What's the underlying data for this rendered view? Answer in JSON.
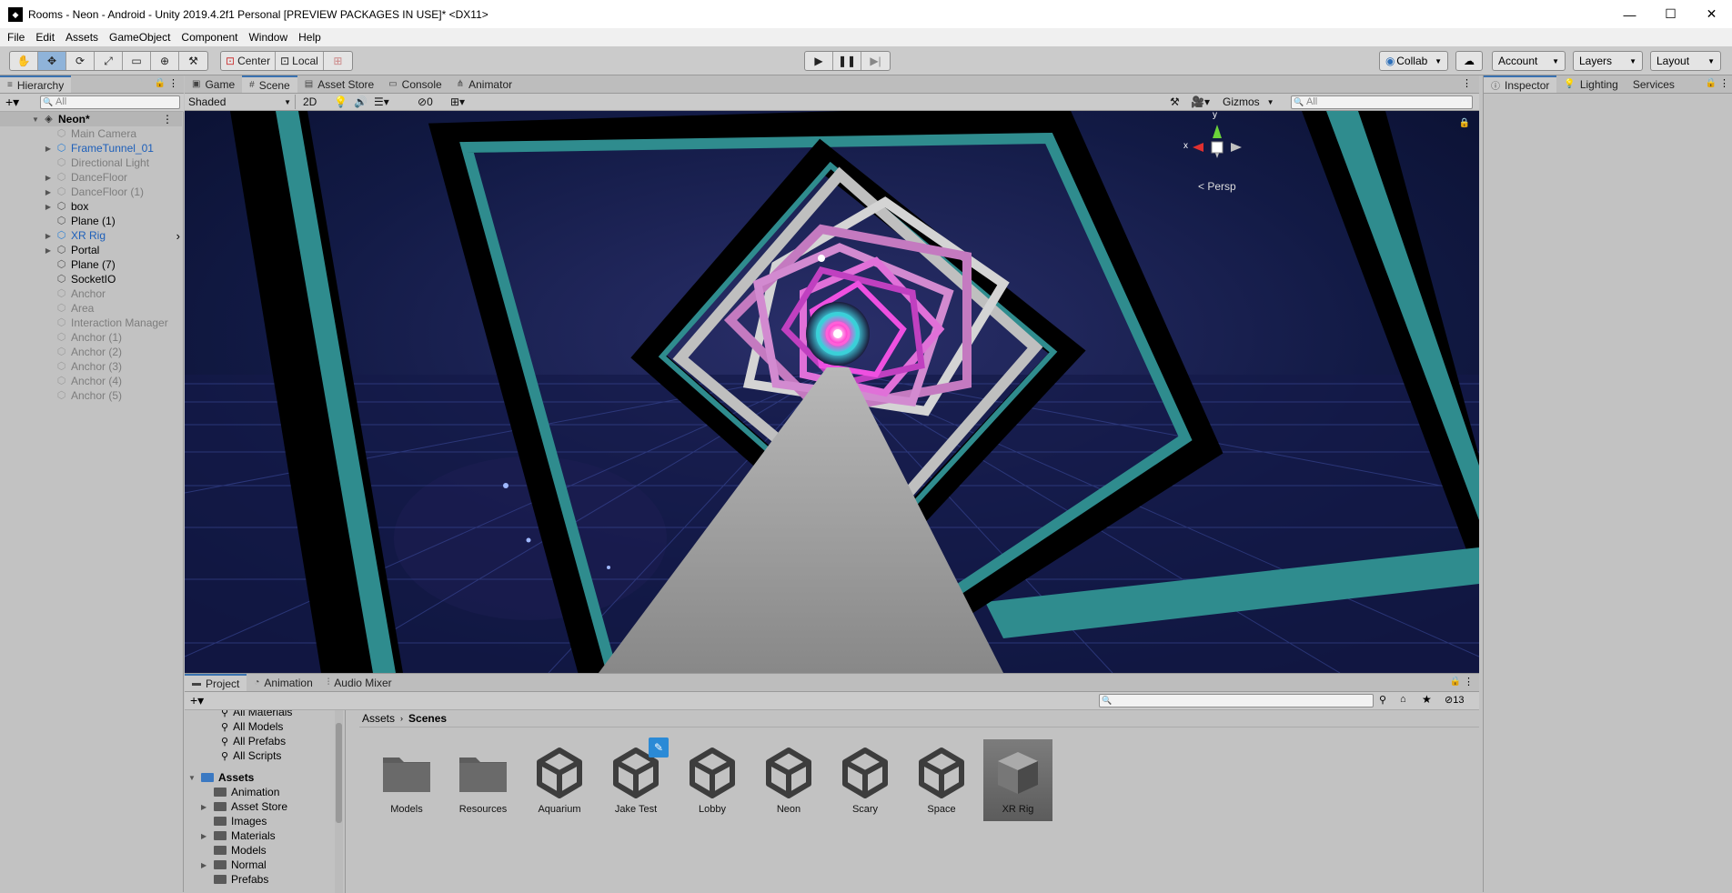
{
  "window": {
    "title": "Rooms - Neon - Android - Unity 2019.4.2f1 Personal [PREVIEW PACKAGES IN USE]* <DX11>",
    "controls": [
      "—",
      "☐",
      "✕"
    ]
  },
  "menu": [
    "File",
    "Edit",
    "Assets",
    "GameObject",
    "Component",
    "Window",
    "Help"
  ],
  "toolbar": {
    "pivot_center": "Center",
    "pivot_local": "Local",
    "collab": "Collab",
    "account": "Account",
    "layers": "Layers",
    "layout": "Layout"
  },
  "hierarchy": {
    "tab": "Hierarchy",
    "search_placeholder": "All",
    "scene": "Neon*",
    "items": [
      {
        "name": "Main Camera",
        "state": "inactive",
        "expand": false
      },
      {
        "name": "FrameTunnel_01",
        "state": "prefab",
        "expand": true
      },
      {
        "name": "Directional Light",
        "state": "inactive",
        "expand": false
      },
      {
        "name": "DanceFloor",
        "state": "inactive",
        "expand": true
      },
      {
        "name": "DanceFloor (1)",
        "state": "inactive",
        "expand": true
      },
      {
        "name": "box",
        "state": "normal",
        "expand": true
      },
      {
        "name": "Plane (1)",
        "state": "normal",
        "expand": false
      },
      {
        "name": "XR Rig",
        "state": "prefab",
        "expand": true
      },
      {
        "name": "Portal",
        "state": "normal",
        "expand": true
      },
      {
        "name": "Plane (7)",
        "state": "normal",
        "expand": false
      },
      {
        "name": "SocketIO",
        "state": "normal",
        "expand": false
      },
      {
        "name": "Anchor",
        "state": "inactive",
        "expand": false
      },
      {
        "name": "Area",
        "state": "inactive",
        "expand": false
      },
      {
        "name": "Interaction Manager",
        "state": "inactive",
        "expand": false
      },
      {
        "name": "Anchor (1)",
        "state": "inactive",
        "expand": false
      },
      {
        "name": "Anchor (2)",
        "state": "inactive",
        "expand": false
      },
      {
        "name": "Anchor (3)",
        "state": "inactive",
        "expand": false
      },
      {
        "name": "Anchor (4)",
        "state": "inactive",
        "expand": false
      },
      {
        "name": "Anchor (5)",
        "state": "inactive",
        "expand": false
      }
    ]
  },
  "scene_tabs": [
    "Game",
    "Scene",
    "Asset Store",
    "Console",
    "Animator"
  ],
  "scene_toolbar": {
    "shading": "Shaded",
    "mode_2d": "2D",
    "hidden_count": "0",
    "gizmos": "Gizmos",
    "search_placeholder": "All"
  },
  "viewport": {
    "projection": "< Persp",
    "axis_x": "x",
    "axis_y": "y"
  },
  "inspector_tabs": [
    "Inspector",
    "Lighting",
    "Services"
  ],
  "project": {
    "tabs": [
      "Project",
      "Animation",
      "Audio Mixer"
    ],
    "hidden_count": "13",
    "tree": [
      {
        "label": "All Materials",
        "kind": "search"
      },
      {
        "label": "All Models",
        "kind": "search"
      },
      {
        "label": "All Prefabs",
        "kind": "search"
      },
      {
        "label": "All Scripts",
        "kind": "search"
      },
      {
        "label": "Assets",
        "kind": "root"
      },
      {
        "label": "Animation",
        "kind": "folder",
        "expand": false
      },
      {
        "label": "Asset Store",
        "kind": "folder",
        "expand": true
      },
      {
        "label": "Images",
        "kind": "folder",
        "expand": false
      },
      {
        "label": "Materials",
        "kind": "folder",
        "expand": true
      },
      {
        "label": "Models",
        "kind": "folder",
        "expand": false
      },
      {
        "label": "Normal",
        "kind": "folder",
        "expand": true
      },
      {
        "label": "Prefabs",
        "kind": "folder",
        "expand": false
      }
    ],
    "breadcrumb": [
      "Assets",
      "Scenes"
    ],
    "assets": [
      {
        "label": "Models",
        "type": "folder"
      },
      {
        "label": "Resources",
        "type": "folder"
      },
      {
        "label": "Aquarium",
        "type": "scene"
      },
      {
        "label": "Jake Test",
        "type": "scene"
      },
      {
        "label": "Lobby",
        "type": "scene"
      },
      {
        "label": "Neon",
        "type": "scene"
      },
      {
        "label": "Scary",
        "type": "scene"
      },
      {
        "label": "Space",
        "type": "scene"
      },
      {
        "label": "XR Rig",
        "type": "prefab"
      }
    ]
  }
}
